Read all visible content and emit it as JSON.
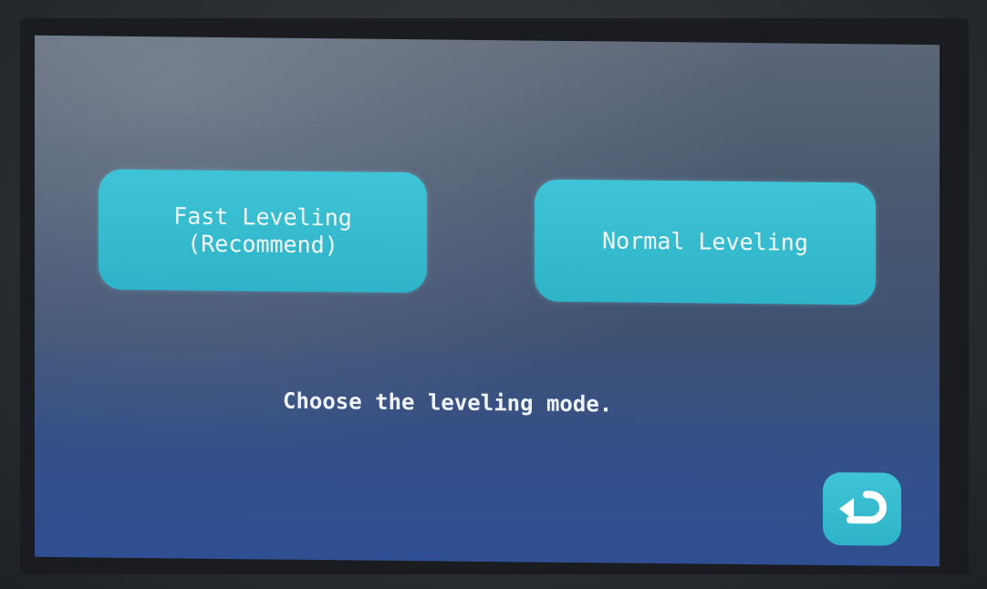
{
  "screen": {
    "buttons": {
      "fast_leveling_line1": "Fast Leveling",
      "fast_leveling_line2": "(Recommend)",
      "normal_leveling": "Normal Leveling"
    },
    "prompt": "Choose the leveling mode.",
    "back_icon": "return-arrow-icon"
  },
  "colors": {
    "button": "#35bacd",
    "screen_background": "#3f5272",
    "text": "#f3fbff"
  }
}
